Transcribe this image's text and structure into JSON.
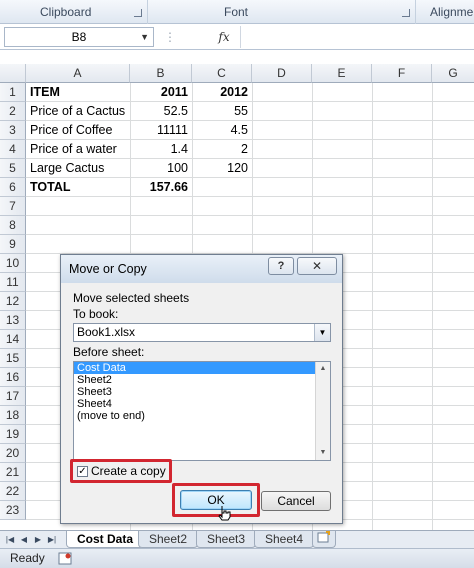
{
  "ribbon": {
    "groups": [
      "Clipboard",
      "Font",
      "Alignme"
    ]
  },
  "formula_bar": {
    "name_box": "B8",
    "fx_label": "fx",
    "formula": ""
  },
  "columns": [
    "A",
    "B",
    "C",
    "D",
    "E",
    "F",
    "G"
  ],
  "rows": [
    "1",
    "2",
    "3",
    "4",
    "5",
    "6",
    "7",
    "8",
    "9",
    "10",
    "11",
    "12",
    "13",
    "14",
    "15",
    "16",
    "17",
    "18",
    "19",
    "20",
    "21",
    "22",
    "23"
  ],
  "cells": {
    "r1": {
      "a": "ITEM",
      "b": "2011",
      "c": "2012"
    },
    "r2": {
      "a": "Price of a Cactus",
      "b": "52.5",
      "c": "55"
    },
    "r3": {
      "a": "Price of Coffee",
      "b": "11111",
      "c": "4.5"
    },
    "r4": {
      "a": "Price of a water",
      "b": "1.4",
      "c": "2"
    },
    "r5": {
      "a": "Large Cactus",
      "b": "100",
      "c": "120"
    },
    "r6": {
      "a": "TOTAL",
      "b": "157.66",
      "c": ""
    }
  },
  "dialog": {
    "title": "Move or Copy",
    "help_label": "?",
    "close_label": "✕",
    "move_label": "Move selected sheets",
    "to_book_label": "To book:",
    "to_book_value": "Book1.xlsx",
    "before_sheet_label": "Before sheet:",
    "before_sheet_items": [
      "Cost Data",
      "Sheet2",
      "Sheet3",
      "Sheet4",
      "(move to end)"
    ],
    "selected_item": "Cost Data",
    "create_copy_label": "Create a copy",
    "create_copy_checked": true,
    "ok_label": "OK",
    "cancel_label": "Cancel"
  },
  "sheet_tabs": [
    "Cost Data",
    "Sheet2",
    "Sheet3",
    "Sheet4"
  ],
  "active_tab": "Cost Data",
  "status": {
    "text": "Ready"
  },
  "colors": {
    "highlight_red": "#d22630",
    "selection_blue": "#3399ff"
  }
}
